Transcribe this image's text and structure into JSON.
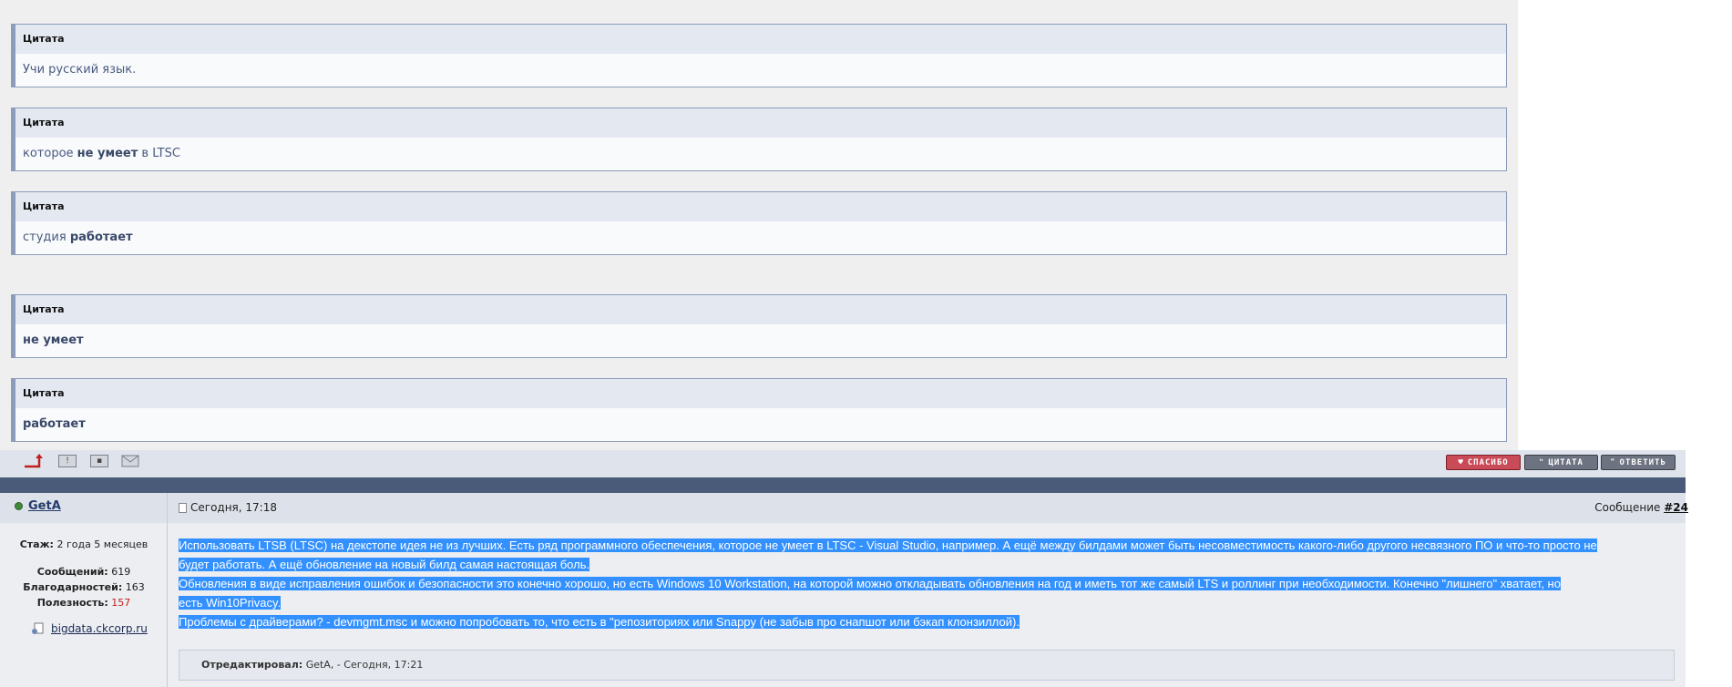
{
  "quotes": [
    {
      "title": "Цитата",
      "parts": [
        {
          "text": "Учи русский язык.",
          "bold": false
        }
      ]
    },
    {
      "title": "Цитата",
      "parts": [
        {
          "text": "которое ",
          "bold": false
        },
        {
          "text": "не умеет",
          "bold": true
        },
        {
          "text": " в LTSC",
          "bold": false
        }
      ]
    },
    {
      "title": "Цитата",
      "parts": [
        {
          "text": "студия ",
          "bold": false
        },
        {
          "text": "работает",
          "bold": true
        }
      ]
    },
    {
      "title": "Цитата",
      "parts": [
        {
          "text": "не умеет",
          "bold": true
        }
      ]
    },
    {
      "title": "Цитата",
      "parts": [
        {
          "text": "работает",
          "bold": true
        }
      ]
    }
  ],
  "actions": {
    "thanks_label": "СПАСИБО",
    "quote_label": "ЦИТАТА",
    "reply_label": "ОТВЕТИТЬ"
  },
  "post": {
    "username": "GetA",
    "date": "Сегодня, 17:18",
    "number_label": "Сообщение",
    "number": "#24",
    "stats": {
      "tenure_label": "Стаж:",
      "tenure_value": "2 года 5 месяцев",
      "posts_label": "Сообщений:",
      "posts_value": "619",
      "thanks_label": "Благодарностей:",
      "thanks_value": "163",
      "usefulness_label": "Полезность:",
      "usefulness_value": "157"
    },
    "website": "bigdata.ckcorp.ru",
    "content_lines": [
      "Использовать LTSB (LTSC) на декстопе идея не из лучших. Есть ряд программного обеспечения, которое не умеет в LTSC - Visual Studio, например. А ещё между билдами может быть несовместимость какого-либо другого несвязного ПО и что-то просто не",
      "будет работать. А ещё обновление на новый билд самая настоящая боль.",
      "Обновления в виде исправления ошибок и безопасности это конечно хорошо, но есть Windows 10 Workstation, на которой можно откладывать обновления на год и иметь тот же самый LTS и роллинг при необходимости. Конечно \"лишнего\" хватает, но",
      "есть Win10Privacy.",
      "Проблемы с драйверами? - devmgmt.msc и можно попробовать то, что есть в \"репозиториях или Snappy (не забыв про снапшот или бэкап клонзиллой)."
    ],
    "edited_label": "Отредактировал:",
    "edited_value": "GetA, - Сегодня, 17:21"
  },
  "colors": {
    "selection": "#3390ff",
    "quote_border": "#8d9cbb",
    "divider": "#4a5b79",
    "thanks_button": "#c94b57"
  }
}
